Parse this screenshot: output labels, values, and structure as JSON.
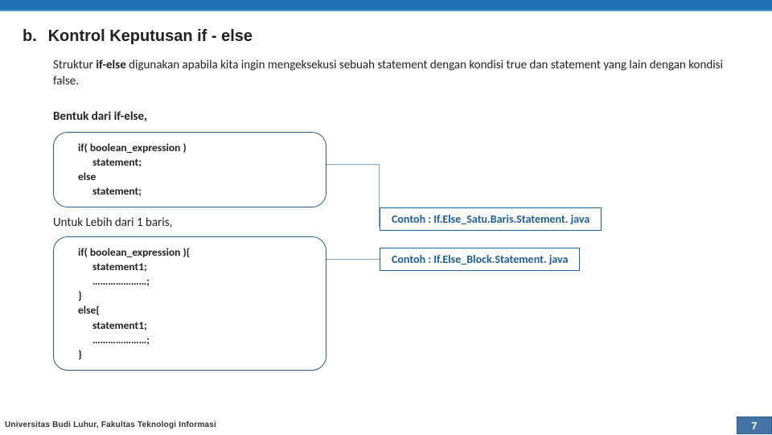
{
  "heading": {
    "letter": "b.",
    "title": "Kontrol Keputusan if - else"
  },
  "intro": {
    "pre": "Struktur ",
    "kw": "if-else",
    "post": " digunakan apabila kita ingin mengeksekusi sebuah  statement dengan kondisi true dan statement yang lain dengan kondisi false."
  },
  "subhead1": {
    "pre": "Bentuk dari ",
    "kw": "if-else",
    "post": ","
  },
  "code1": {
    "l1": "if( boolean_expression )",
    "l2": "statement;",
    "l3": "else",
    "l4": "statement;"
  },
  "subhead2": "Untuk Lebih dari 1 baris,",
  "code2": {
    "l1": "if( boolean_expression ){",
    "l2": "statement1;",
    "l3": "…………………;",
    "l4": "}",
    "l5": "else{",
    "l6": "statement1;",
    "l7": "…………………;",
    "l8": "}"
  },
  "example1": "Contoh : If.Else_Satu.Baris.Statement. java",
  "example2": "Contoh : If.Else_Block.Statement. java",
  "footer": "Universitas Budi Luhur, Fakultas Teknologi Informasi",
  "page": "7"
}
